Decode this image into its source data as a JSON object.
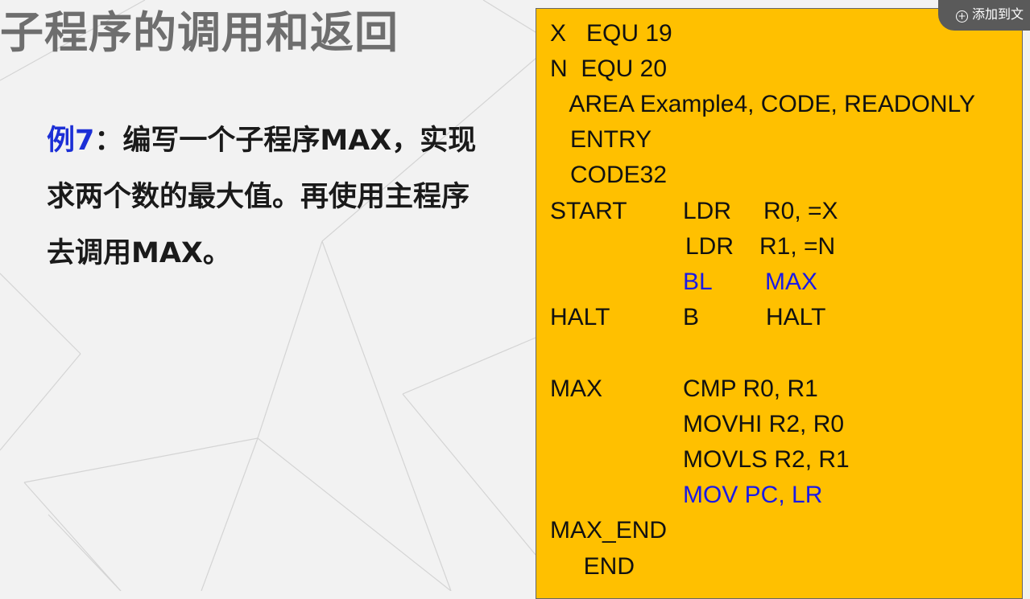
{
  "slide": {
    "title": "子程序的调用和返回",
    "example_label": "例7",
    "example_text": "：编写一个子程序MAX，实现求两个数的最大值。再使用主程序去调用MAX。"
  },
  "toolbar": {
    "add_button_label": "添加到文"
  },
  "code": {
    "lines": [
      {
        "c1": "X   EQU 19"
      },
      {
        "c1": "N  EQU 20"
      },
      {
        "c1": "   AREA Example4, CODE, READONLY"
      },
      {
        "c1": "   ENTRY"
      },
      {
        "c1": "   CODE32"
      },
      {
        "c1": "START",
        "c2": "LDR",
        "c3": "R0, =X"
      },
      {
        "c2": "LDR",
        "c3": "R1, =N"
      },
      {
        "c2": "BL",
        "c3": "MAX"
      },
      {
        "c1": "HALT",
        "c2": "B",
        "c3": "HALT"
      },
      {
        "c1": ""
      },
      {
        "c1": "MAX",
        "c2": "CMP R0, R1"
      },
      {
        "c2": "MOVHI R2, R0"
      },
      {
        "c2": "MOVLS R2, R1"
      },
      {
        "c2": "MOV PC, LR"
      },
      {
        "c1": "MAX_END"
      },
      {
        "c1": "     END"
      }
    ]
  }
}
